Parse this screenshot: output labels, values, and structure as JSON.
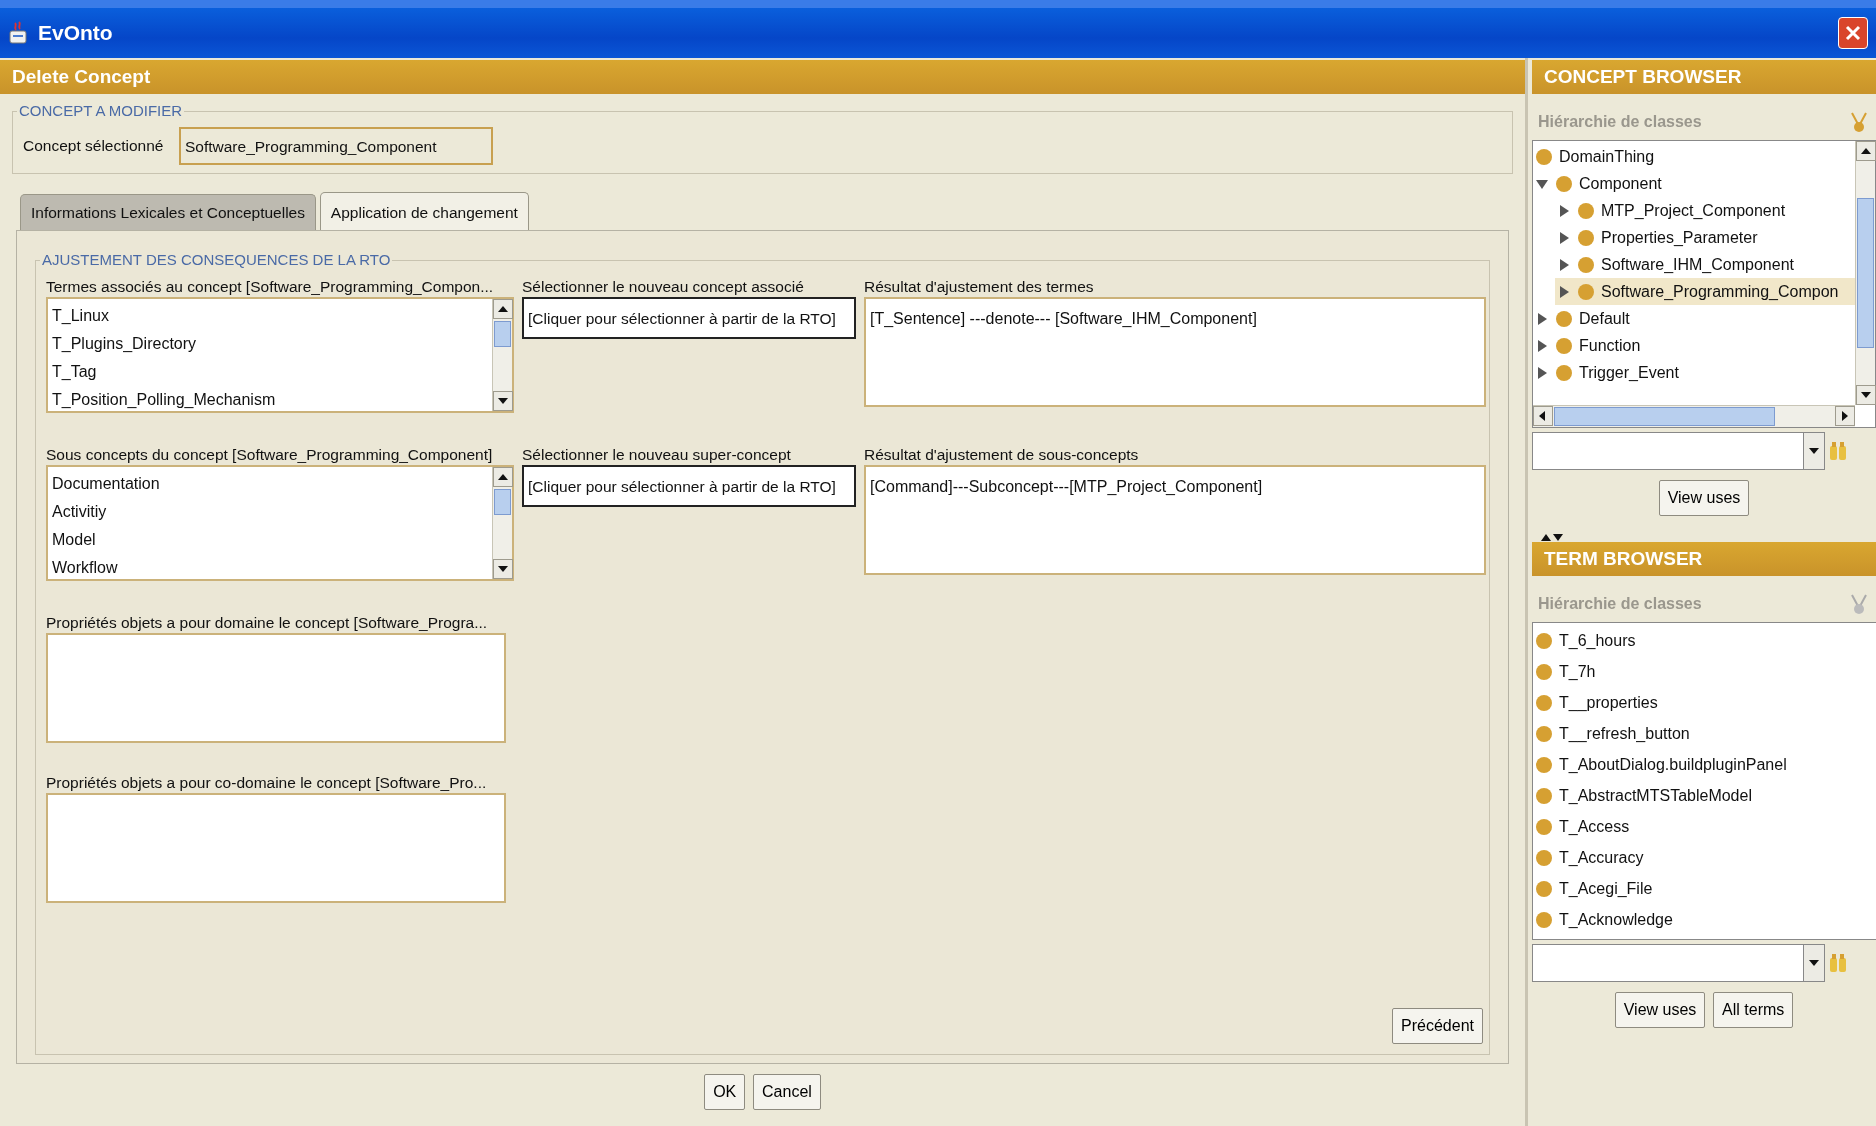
{
  "window": {
    "title": "EvOnto"
  },
  "panel": {
    "title": "Delete Concept"
  },
  "concept_group": {
    "legend": "CONCEPT A MODIFIER",
    "label": "Concept sélectionné",
    "value": "Software_Programming_Component"
  },
  "tabs": [
    {
      "label": "Informations Lexicales et Conceptuelles",
      "selected": false
    },
    {
      "label": "Application de changement",
      "selected": true
    }
  ],
  "adjustment": {
    "legend": "AJUSTEMENT DES CONSEQUENCES DE LA RTO",
    "rows": [
      {
        "list_label": "Termes associés au concept [Software_Programming_Compon...",
        "items": [
          "T_Linux",
          "T_Plugins_Directory",
          "T_Tag",
          "T_Position_Polling_Mechanism"
        ],
        "select_label": "Sélectionner le nouveau concept associé",
        "select_value": "[Cliquer pour sélectionner à partir de la RTO]",
        "result_label": "Résultat d'ajustement des termes",
        "result_value": "[T_Sentence] ---denote--- [Software_IHM_Component]"
      },
      {
        "list_label": "Sous concepts du concept [Software_Programming_Component]",
        "items": [
          "Documentation",
          "Activitiy",
          "Model",
          "Workflow"
        ],
        "select_label": "Sélectionner le nouveau super-concept",
        "select_value": "[Cliquer pour sélectionner à partir de la RTO]",
        "result_label": "Résultat d'ajustement de sous-concepts",
        "result_value": "[Command]---Subconcept---[MTP_Project_Component]"
      }
    ],
    "properties": [
      {
        "label": "Propriétés objets a pour domaine le concept [Software_Progra..."
      },
      {
        "label": "Propriétés objets a pour co-domaine le concept [Software_Pro..."
      }
    ],
    "previous_button": "Précédent"
  },
  "buttons": [
    "OK",
    "Cancel"
  ],
  "concept_browser": {
    "title": "CONCEPT BROWSER",
    "subtitle": "Hiérarchie de classes",
    "tree": [
      {
        "label": "DomainThing",
        "selected": false
      },
      {
        "label": "Component",
        "selected": false,
        "expanded": true,
        "children": [
          {
            "label": "MTP_Project_Component",
            "selected": false,
            "expanded": false
          },
          {
            "label": "Properties_Parameter",
            "selected": false,
            "expanded": false
          },
          {
            "label": "Software_IHM_Component",
            "selected": false,
            "expanded": false
          },
          {
            "label": "Software_Programming_Compon",
            "selected": true,
            "expanded": false
          }
        ]
      },
      {
        "label": "Default",
        "selected": false,
        "expanded": false
      },
      {
        "label": "Function",
        "selected": false,
        "expanded": false
      },
      {
        "label": "Trigger_Event",
        "selected": false,
        "expanded": false
      }
    ],
    "buttons": [
      "View uses"
    ]
  },
  "term_browser": {
    "title": "TERM BROWSER",
    "subtitle": "Hiérarchie de classes",
    "items": [
      "T_6_hours",
      "T_7h",
      "T__properties",
      "T__refresh_button",
      "T_AboutDialog.buildpluginPanel",
      "T_AbstractMTSTableModel",
      "T_Access",
      "T_Accuracy",
      "T_Acegi_File",
      "T_Acknowledge"
    ],
    "buttons": [
      "View uses",
      "All terms"
    ]
  }
}
